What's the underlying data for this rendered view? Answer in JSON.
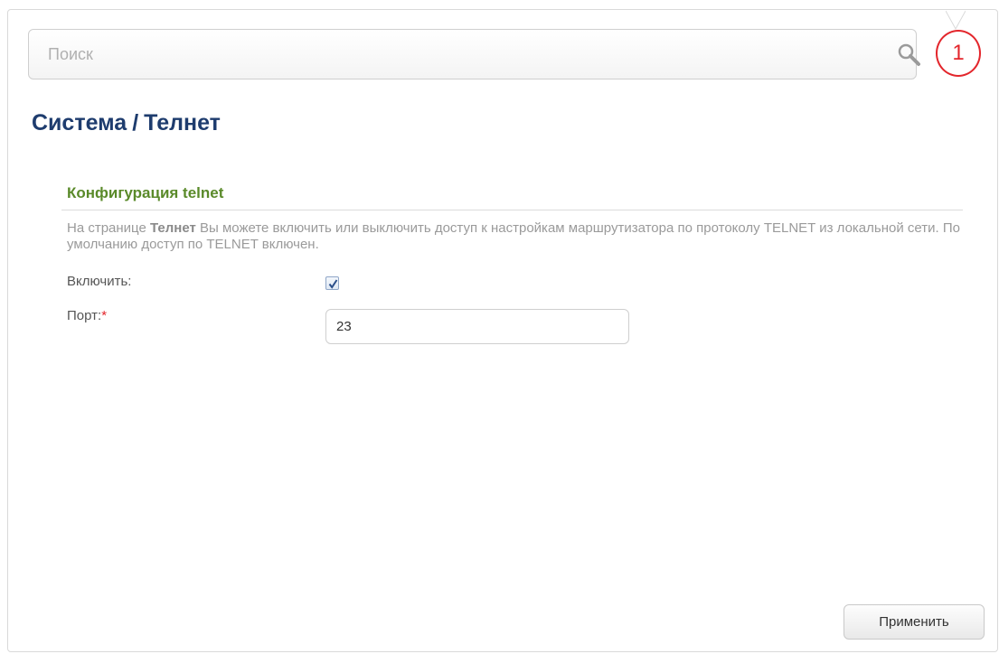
{
  "search": {
    "placeholder": "Поиск"
  },
  "notifications": {
    "count": "1"
  },
  "breadcrumb": {
    "section": "Система",
    "separator": "/",
    "page": "Телнет"
  },
  "telnet_section": {
    "title": "Конфигурация telnet",
    "description_prefix": "На странице ",
    "description_bold": "Телнет",
    "description_suffix": " Вы можете включить или выключить доступ к настройкам маршрутизатора по протоколу TELNET из локальной сети. По умолчанию доступ по TELNET включен."
  },
  "form": {
    "enable_label": "Включить:",
    "enable_checked": true,
    "port_label": "Порт:",
    "required_mark": "*",
    "port_value": "23"
  },
  "actions": {
    "apply_label": "Применить"
  },
  "colors": {
    "title": "#1e3c6e",
    "section_title": "#5a8a2a",
    "badge": "#e3262c"
  }
}
